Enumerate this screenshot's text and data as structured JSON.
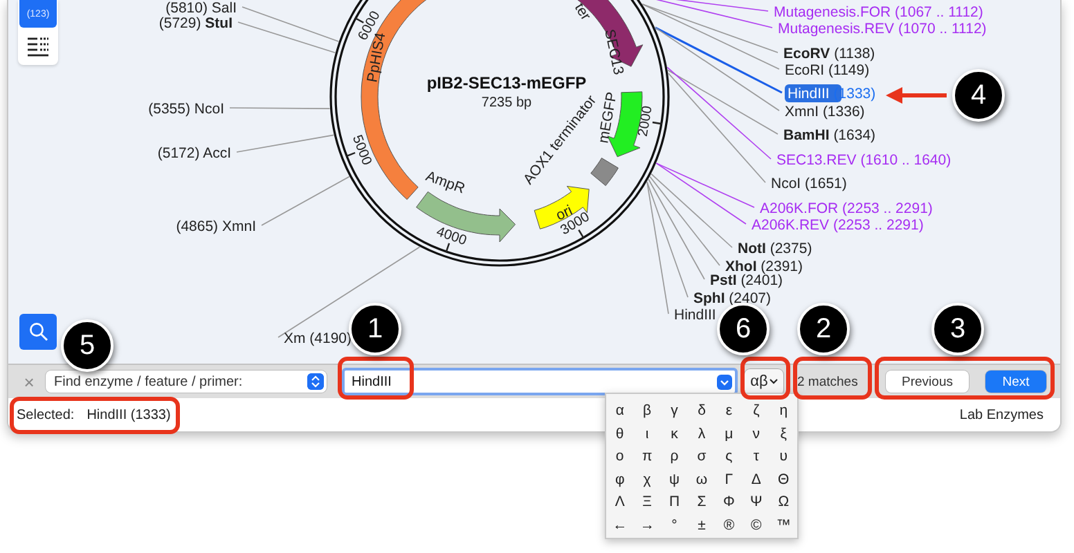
{
  "sidebar": {
    "count_button": "(123)"
  },
  "map": {
    "title": "pIB2-SEC13-mEGFP",
    "length": "7235 bp",
    "ticks": [
      "2000",
      "3000",
      "4000",
      "5000",
      "6000"
    ],
    "features": [
      {
        "label": "ter",
        "kind": "label"
      },
      {
        "label": "SEC13",
        "kind": "arrow",
        "color": "#8e2a6a"
      },
      {
        "label": "mEGFP",
        "kind": "arrow",
        "color": "#22ee22"
      },
      {
        "label": "AOX1 terminator",
        "kind": "box",
        "color": "#8a8a8a"
      },
      {
        "label": "ori",
        "kind": "arrow",
        "color": "#ffff00"
      },
      {
        "label": "AmpR",
        "kind": "arrow",
        "color": "#93bf8c"
      },
      {
        "label": "PpHIS4",
        "kind": "bar",
        "color": "#f5803e"
      }
    ],
    "sites": [
      {
        "name": "SalI",
        "position": "(5810)",
        "kind": "enzyme",
        "bold": false,
        "selected": false
      },
      {
        "name": "StuI",
        "position": "(5729)",
        "kind": "enzyme",
        "bold": true,
        "selected": false
      },
      {
        "name": "NcoI",
        "position": "(5355)",
        "kind": "enzyme",
        "bold": false,
        "selected": false
      },
      {
        "name": "AccI",
        "position": "(5172)",
        "kind": "enzyme",
        "bold": false,
        "selected": false
      },
      {
        "name": "XmnI",
        "position": "(4865)",
        "kind": "enzyme",
        "bold": false,
        "selected": false
      },
      {
        "name": "Xm",
        "position": "(4190)",
        "kind": "enzyme",
        "bold": false,
        "selected": false
      },
      {
        "name": "Mutagenesis.FOR",
        "position": "(1067 .. 1112)",
        "kind": "primer",
        "bold": false,
        "selected": false
      },
      {
        "name": "Mutagenesis.REV",
        "position": "(1070 .. 1112)",
        "kind": "primer",
        "bold": false,
        "selected": false
      },
      {
        "name": "EcoRV",
        "position": "(1138)",
        "kind": "enzyme",
        "bold": true,
        "selected": false
      },
      {
        "name": "EcoRI",
        "position": "(1149)",
        "kind": "enzyme",
        "bold": false,
        "selected": false
      },
      {
        "name": "HindIII",
        "position": "(1333)",
        "kind": "enzyme",
        "bold": false,
        "selected": true
      },
      {
        "name": "XmnI",
        "position": "(1336)",
        "kind": "enzyme",
        "bold": false,
        "selected": false
      },
      {
        "name": "BamHI",
        "position": "(1634)",
        "kind": "enzyme",
        "bold": true,
        "selected": false
      },
      {
        "name": "SEC13.REV",
        "position": "(1610 .. 1640)",
        "kind": "primer",
        "bold": false,
        "selected": false
      },
      {
        "name": "NcoI",
        "position": "(1651)",
        "kind": "enzyme",
        "bold": false,
        "selected": false
      },
      {
        "name": "A206K.FOR",
        "position": "(2253 .. 2291)",
        "kind": "primer",
        "bold": false,
        "selected": false
      },
      {
        "name": "A206K.REV",
        "position": "(2253 .. 2291)",
        "kind": "primer",
        "bold": false,
        "selected": false
      },
      {
        "name": "NotI",
        "position": "(2375)",
        "kind": "enzyme",
        "bold": true,
        "selected": false
      },
      {
        "name": "XhoI",
        "position": "(2391)",
        "kind": "enzyme",
        "bold": true,
        "selected": false
      },
      {
        "name": "PstI",
        "position": "(2401)",
        "kind": "enzyme",
        "bold": true,
        "selected": false
      },
      {
        "name": "SphI",
        "position": "(2407)",
        "kind": "enzyme",
        "bold": true,
        "selected": false
      },
      {
        "name": "HindIII",
        "kind": "enzyme",
        "bold": false,
        "selected": false
      }
    ]
  },
  "find_bar": {
    "close": "×",
    "mode": "Find enzyme / feature / primer:",
    "search": {
      "value": "HindIII"
    },
    "symbols_button": "αβ",
    "matches": "2 matches",
    "buttons": [
      {
        "label": "Previous",
        "primary": false
      },
      {
        "label": "Next",
        "primary": true
      }
    ]
  },
  "symbols_popup": [
    "α",
    "β",
    "γ",
    "δ",
    "ε",
    "ζ",
    "η",
    "θ",
    "ι",
    "κ",
    "λ",
    "μ",
    "ν",
    "ξ",
    "ο",
    "π",
    "ρ",
    "σ",
    "ς",
    "τ",
    "υ",
    "φ",
    "χ",
    "ψ",
    "ω",
    "Γ",
    "Δ",
    "Θ",
    "Λ",
    "Ξ",
    "Π",
    "Σ",
    "Φ",
    "Ψ",
    "Ω",
    "←",
    "→",
    "°",
    "±",
    "®",
    "©",
    "™"
  ],
  "status_bar": {
    "selected_label": "Selected:",
    "selected_value": "HindIII (1333)",
    "library": "Lab Enzymes"
  },
  "callouts": [
    {
      "number": "1"
    },
    {
      "number": "2"
    },
    {
      "number": "3"
    },
    {
      "number": "4"
    },
    {
      "number": "5"
    },
    {
      "number": "6"
    }
  ]
}
